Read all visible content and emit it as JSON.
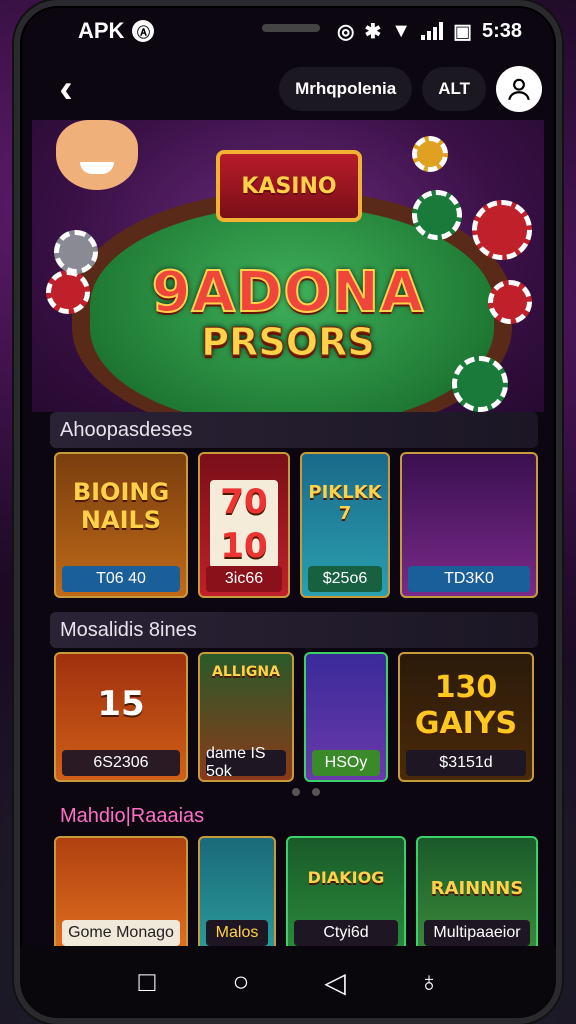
{
  "status": {
    "carrier": "APK",
    "carrier_badge": "Ⓐ",
    "time": "5:38"
  },
  "topbar": {
    "back_icon": "back-arrow-icon",
    "pill_1": "Mrhqpolenia",
    "pill_2": "ALT"
  },
  "hero": {
    "sign": "KASINO",
    "title_line1": "9ADONA",
    "title_line2": "PRSORS"
  },
  "sections": [
    {
      "title": "Ahoopasdeses",
      "cards": [
        {
          "art_text": "BIOING NAILS",
          "label": "T06 40"
        },
        {
          "art_text": "70 10",
          "label": "3ic66"
        },
        {
          "art_text": "PIKLKK 7",
          "label": "$25o6"
        },
        {
          "art_text": "",
          "label": "TD3K0"
        }
      ]
    },
    {
      "title": "Mosalidis 8ines",
      "cards": [
        {
          "art_text": "15",
          "label": "6S2306"
        },
        {
          "art_text": "ALLIGNA",
          "label": "dame IS 5ok"
        },
        {
          "art_text": "",
          "label": "HSOy"
        },
        {
          "art_text": "130 GAIYS",
          "label": "$3151d"
        }
      ]
    },
    {
      "title": "Mahdio|Raaaias",
      "cards": [
        {
          "art_text": "",
          "label": "Gome Monago"
        },
        {
          "art_text": "",
          "label": "Malos"
        },
        {
          "art_text": "DIAKIOG",
          "label": "Ctyi6d"
        },
        {
          "art_text": "RAINNNS",
          "label": "Multipaaeior"
        }
      ]
    }
  ],
  "colors": {
    "card_border": "#c79a3a",
    "accent_red": "#c0202a",
    "felt_green": "#1f7a34"
  }
}
